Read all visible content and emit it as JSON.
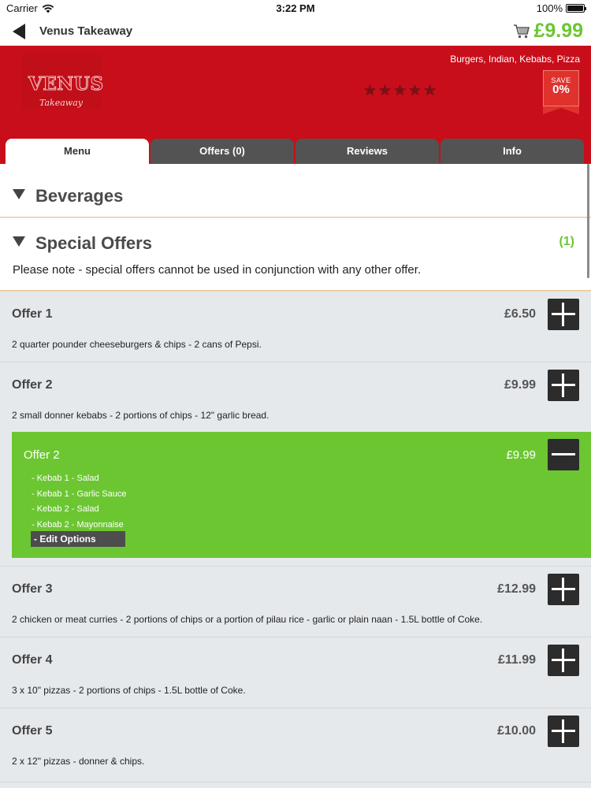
{
  "status_bar": {
    "carrier": "Carrier",
    "time": "3:22 PM",
    "battery": "100%",
    "battery_level": 1.0
  },
  "nav": {
    "title": "Venus Takeaway",
    "cart_total": "£9.99"
  },
  "banner": {
    "logo_main": "VENUS",
    "logo_sub": "Takeaway",
    "categories": "Burgers, Indian, Kebabs, Pizza",
    "rating_stars": 0,
    "save_label": "SAVE",
    "save_value": "0%"
  },
  "tabs": [
    {
      "label": "Menu"
    },
    {
      "label": "Offers (0)"
    },
    {
      "label": "Reviews"
    },
    {
      "label": "Info"
    }
  ],
  "sections": {
    "beverages": {
      "title": "Beverages"
    },
    "special_offers": {
      "title": "Special Offers",
      "count": "(1)",
      "note": "Please note - special offers cannot be used in conjunction with any other offer."
    }
  },
  "offers": [
    {
      "name": "Offer 1",
      "price": "£6.50",
      "description": "2 quarter pounder cheeseburgers & chips - 2 cans of Pepsi."
    },
    {
      "name": "Offer 2",
      "price": "£9.99",
      "description": "2 small donner kebabs - 2 portions of chips - 12\" garlic bread."
    },
    {
      "name": "Offer 3",
      "price": "£12.99",
      "description": "2 chicken or meat curries - 2 portions of chips or a portion of pilau rice - garlic or plain naan - 1.5L bottle of Coke."
    },
    {
      "name": "Offer 4",
      "price": "£11.99",
      "description": "3 x 10\" pizzas - 2 portions of chips - 1.5L bottle of Coke."
    },
    {
      "name": "Offer 5",
      "price": "£10.00",
      "description": "2 x 12\" pizzas - donner & chips."
    }
  ],
  "selected_offer": {
    "name": "Offer 2",
    "price": "£9.99",
    "options": [
      "- Kebab 1 - Salad",
      "- Kebab 1 - Garlic Sauce",
      "- Kebab 2 - Salad",
      "- Kebab 2 - Mayonnaise"
    ],
    "edit_label": "- Edit Options"
  },
  "colors": {
    "brand_red": "#c80e1a",
    "accent_green": "#6cc632",
    "tab_dark": "#535353"
  }
}
